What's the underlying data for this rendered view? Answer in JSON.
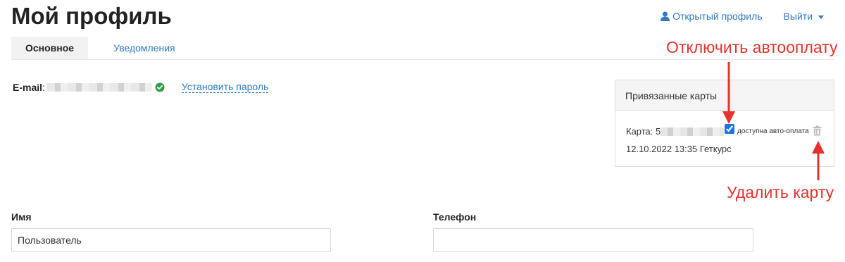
{
  "page": {
    "title": "Мой профиль"
  },
  "header": {
    "open_profile": "Открытый профиль",
    "logout": "Выйти"
  },
  "tabs": [
    {
      "label": "Основное",
      "active": true
    },
    {
      "label": "Уведомления",
      "active": false
    }
  ],
  "email": {
    "label": "E-mail",
    "colon": ":",
    "verified_icon": "check-circle-icon",
    "set_password": "Установить пароль"
  },
  "cards": {
    "header": "Привязанные карты",
    "items": [
      {
        "prefix": "Карта: 5",
        "autopay_checked": true,
        "autopay_label": "доступна авто-оплата",
        "details": "12.10.2022 13:35 Геткурс"
      }
    ]
  },
  "annotations": {
    "autopay": "Отключить автооплату",
    "delete": "Удалить карту",
    "color": "#e5322d"
  },
  "form": {
    "name": {
      "label": "Имя",
      "value": "Пользователь"
    },
    "phone": {
      "label": "Телефон",
      "value": ""
    }
  },
  "colors": {
    "link": "#2f7bbf",
    "accent": "#e5322d",
    "verified": "#2e9e44"
  }
}
